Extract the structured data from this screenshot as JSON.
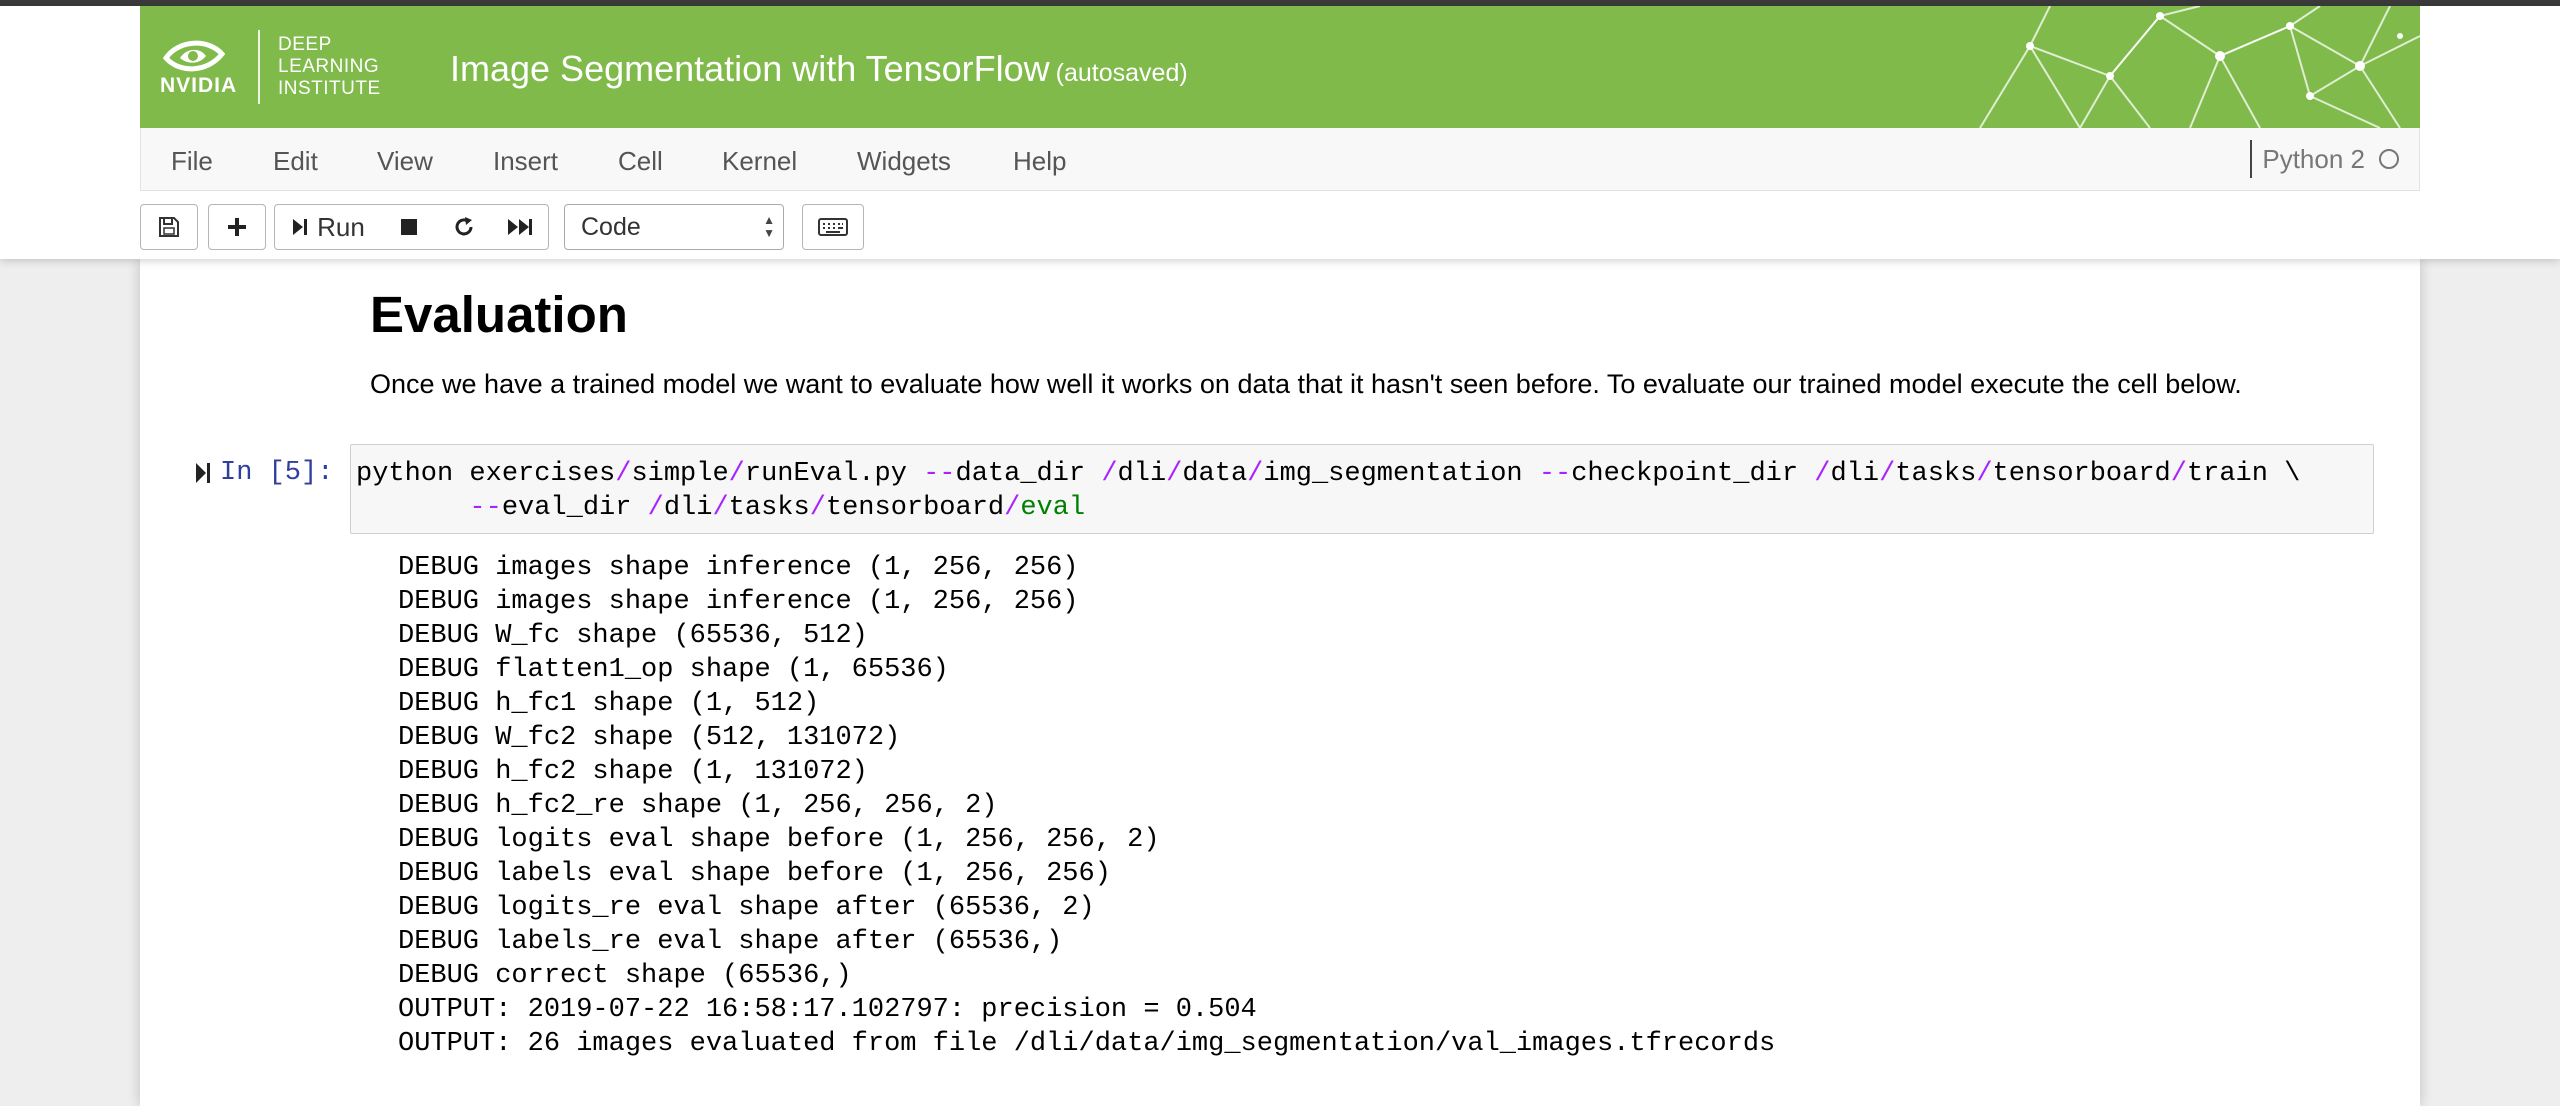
{
  "banner": {
    "logo_mark": "NVIDIA",
    "logo_text": [
      "DEEP",
      "LEARNING",
      "INSTITUTE"
    ],
    "notebook_title": "Image Segmentation with TensorFlow",
    "save_status": "(autosaved)",
    "accent_color": "#7fba4a"
  },
  "menu": {
    "items": [
      "File",
      "Edit",
      "View",
      "Insert",
      "Cell",
      "Kernel",
      "Widgets",
      "Help"
    ],
    "kernel_name": "Python 2"
  },
  "toolbar": {
    "run_label": "Run",
    "cell_type": "Code",
    "icons": [
      "save-icon",
      "plus-icon",
      "run-icon",
      "stop-icon",
      "restart-icon",
      "fast-forward-icon",
      "keyboard-icon"
    ]
  },
  "notebook": {
    "heading": "Evaluation",
    "paragraph": "Once we have a trained model we want to evaluate how well it works on data that it hasn't seen before. To evaluate our trained model execute the cell below.",
    "cell_prompt": "In [5]:",
    "cell_source": [
      "python exercises/simple/runEval.py --data_dir /dli/data/img_segmentation --checkpoint_dir /dli/tasks/tensorboard/train \\",
      "       --eval_dir /dli/tasks/tensorboard/eval"
    ],
    "output_lines": [
      "DEBUG images shape inference (1, 256, 256)",
      "DEBUG images shape inference (1, 256, 256)",
      "DEBUG W_fc shape (65536, 512)",
      "DEBUG flatten1_op shape (1, 65536)",
      "DEBUG h_fc1 shape (1, 512)",
      "DEBUG W_fc2 shape (512, 131072)",
      "DEBUG h_fc2 shape (1, 131072)",
      "DEBUG h_fc2_re shape (1, 256, 256, 2)",
      "DEBUG logits eval shape before (1, 256, 256, 2)",
      "DEBUG labels eval shape before (1, 256, 256)",
      "DEBUG logits_re eval shape after (65536, 2)",
      "DEBUG labels_re eval shape after (65536,)",
      "DEBUG correct shape (65536,)",
      "OUTPUT: 2019-07-22 16:58:17.102797: precision = 0.504",
      "OUTPUT: 26 images evaluated from file /dli/data/img_segmentation/val_images.tfrecords"
    ]
  }
}
